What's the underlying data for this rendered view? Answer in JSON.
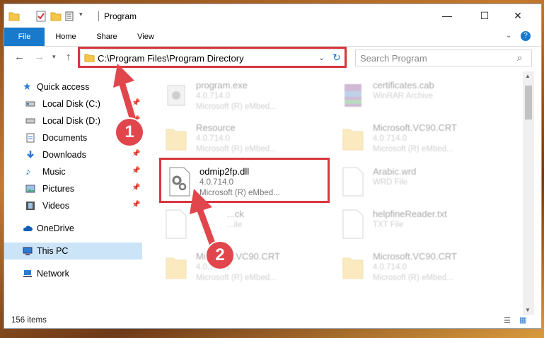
{
  "window": {
    "title": "Program"
  },
  "ribbon": {
    "tabs": [
      "File",
      "Home",
      "Share",
      "View"
    ]
  },
  "address": {
    "path": "C:\\Program Files\\Program Directory",
    "search_placeholder": "Search Program"
  },
  "nav": {
    "items": [
      {
        "label": "Quick access",
        "icon": "star-icon"
      },
      {
        "label": "Local Disk (C:)",
        "icon": "drive-icon"
      },
      {
        "label": "Local Disk (D:)",
        "icon": "drive-icon"
      },
      {
        "label": "Documents",
        "icon": "documents-icon"
      },
      {
        "label": "Downloads",
        "icon": "download-icon"
      },
      {
        "label": "Music",
        "icon": "music-icon"
      },
      {
        "label": "Pictures",
        "icon": "pictures-icon"
      },
      {
        "label": "Videos",
        "icon": "videos-icon"
      },
      {
        "label": "OneDrive",
        "icon": "cloud-icon"
      },
      {
        "label": "This PC",
        "icon": "computer-icon"
      },
      {
        "label": "Network",
        "icon": "network-icon"
      }
    ]
  },
  "files": [
    {
      "name": "program.exe",
      "line1": "4.0.714.0",
      "line2": "Microsoft (R) eMbed..."
    },
    {
      "name": "certificates.cab",
      "line1": "WinRAR Archive",
      "line2": ""
    },
    {
      "name": "Resource",
      "line1": "4.0.714.0",
      "line2": "Microsoft (R) eMbed..."
    },
    {
      "name": "Microsoft.VC90.CRT",
      "line1": "4.0.714.0",
      "line2": "Microsoft (R) eMbed..."
    },
    {
      "name": "odmip2fp.dll",
      "line1": "4.0.714.0",
      "line2": "Microsoft (R) eMbed..."
    },
    {
      "name": "Arabic.wrd",
      "line1": "WRD File",
      "line2": ""
    },
    {
      "name": "...ck",
      "line1": "...ile",
      "line2": ""
    },
    {
      "name": "helpfineReader.txt",
      "line1": "TXT File",
      "line2": ""
    },
    {
      "name": "Microsoft.VC90.CRT",
      "line1": "4.0.714.0",
      "line2": "Microsoft (R) eMbed..."
    },
    {
      "name": "Microsoft.VC90.CRT",
      "line1": "4.0.714.0",
      "line2": "Microsoft (R) eMbed..."
    }
  ],
  "status": {
    "items_count": "156 items"
  },
  "annotations": {
    "step1": "1",
    "step2": "2",
    "color": "#d9363e"
  }
}
